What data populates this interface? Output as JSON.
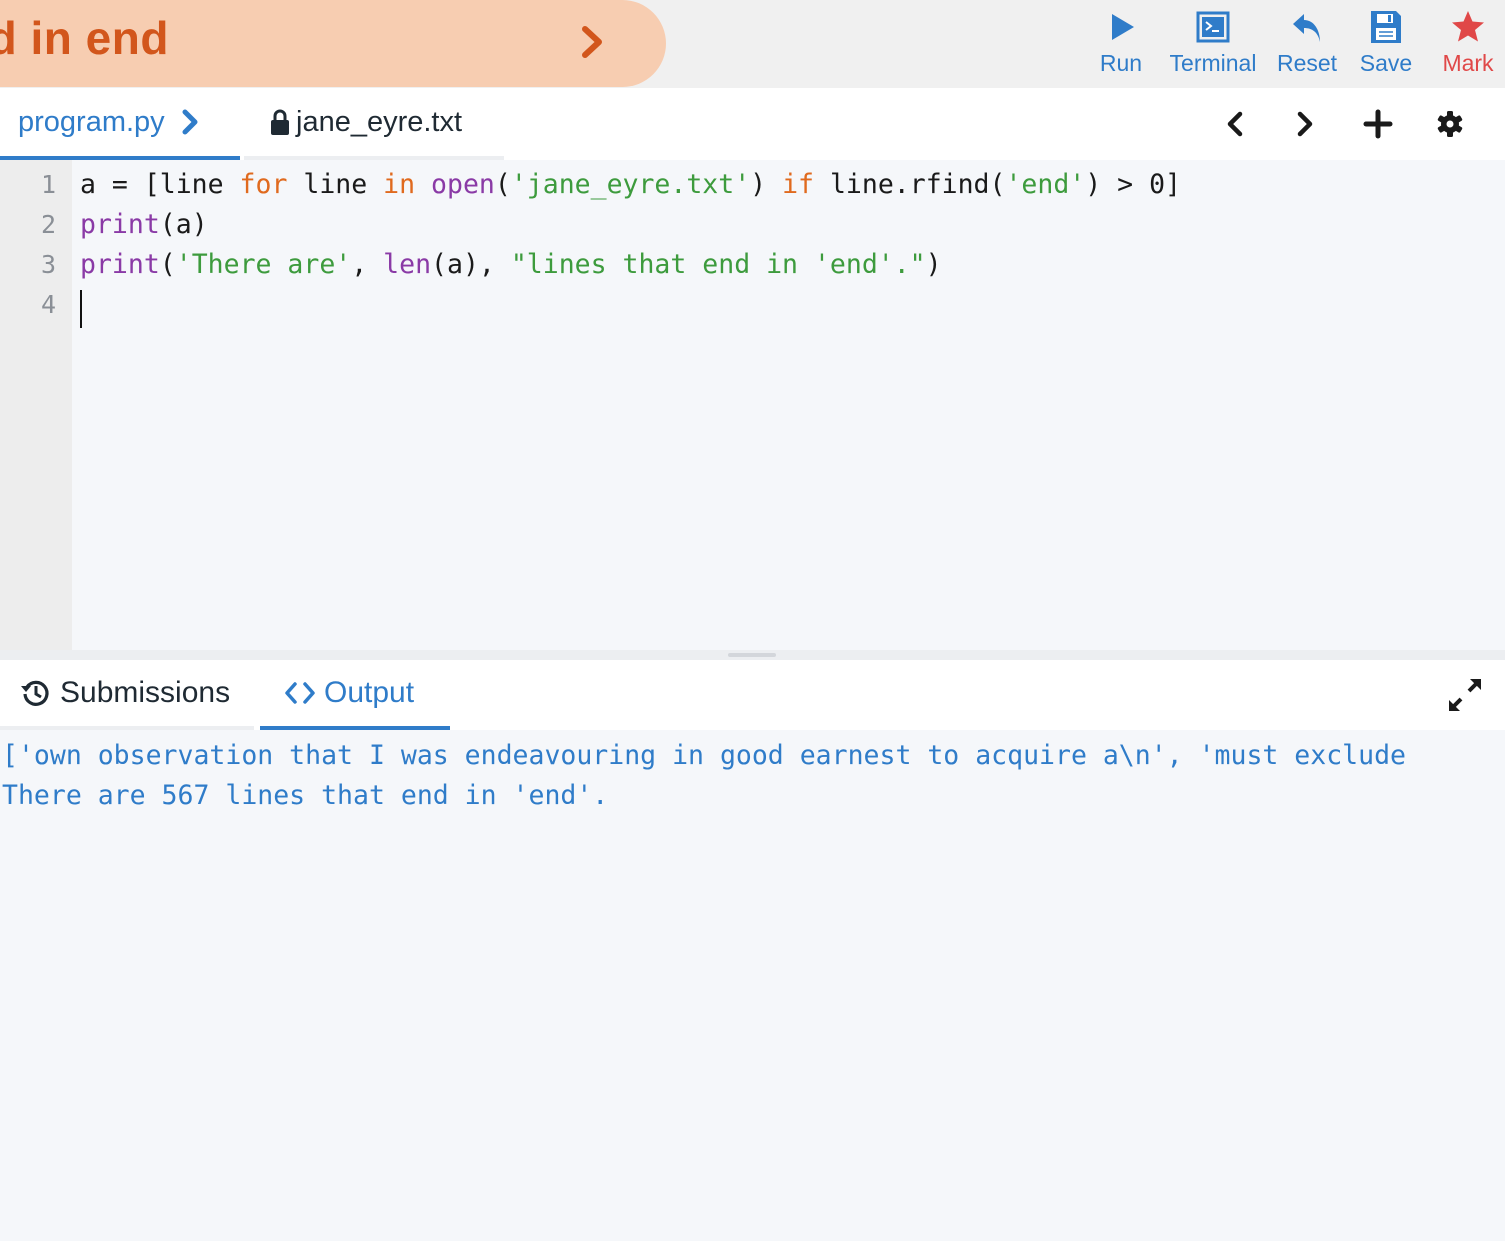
{
  "header": {
    "title": "nd in end",
    "buttons": {
      "run": "Run",
      "terminal": "Terminal",
      "reset": "Reset",
      "save": "Save",
      "mark": "Mark"
    },
    "icons": [
      "chevron-right-icon",
      "play-icon",
      "terminal-icon",
      "reset-icon",
      "save-icon",
      "star-icon"
    ]
  },
  "file_tabs": {
    "program": "program.py",
    "jane": "jane_eyre.txt"
  },
  "editor": {
    "line_numbers": [
      "1",
      "2",
      "3",
      "4"
    ],
    "lines": [
      [
        {
          "t": "a = [line ",
          "c": ""
        },
        {
          "t": "for",
          "c": "kw"
        },
        {
          "t": " line ",
          "c": ""
        },
        {
          "t": "in",
          "c": "kw"
        },
        {
          "t": " ",
          "c": ""
        },
        {
          "t": "open",
          "c": "bi"
        },
        {
          "t": "(",
          "c": ""
        },
        {
          "t": "'jane_eyre.txt'",
          "c": "st"
        },
        {
          "t": ") ",
          "c": ""
        },
        {
          "t": "if",
          "c": "kw"
        },
        {
          "t": " line.rfind(",
          "c": ""
        },
        {
          "t": "'end'",
          "c": "st"
        },
        {
          "t": ") > 0]",
          "c": ""
        }
      ],
      [
        {
          "t": "print",
          "c": "bi"
        },
        {
          "t": "(a)",
          "c": ""
        }
      ],
      [
        {
          "t": "print",
          "c": "bi"
        },
        {
          "t": "(",
          "c": ""
        },
        {
          "t": "'There are'",
          "c": "st"
        },
        {
          "t": ", ",
          "c": ""
        },
        {
          "t": "len",
          "c": "bi"
        },
        {
          "t": "(a), ",
          "c": ""
        },
        {
          "t": "\"lines that end in 'end'.\"",
          "c": "st"
        },
        {
          "t": ")",
          "c": ""
        }
      ],
      []
    ]
  },
  "bottom_tabs": {
    "submissions": "Submissions",
    "output": "Output"
  },
  "output": {
    "lines": [
      "['own observation that I was endeavouring in good earnest to acquire a\\n', 'must exclude",
      "There are 567 lines that end in 'end'."
    ]
  },
  "colors": {
    "accent": "#2f7cc9",
    "title": "#d2561c",
    "title_bg": "#f7cdb1",
    "mark": "#e04848",
    "keyword": "#e06a1e",
    "builtin": "#8a3aa6",
    "string": "#3d9b3d"
  }
}
